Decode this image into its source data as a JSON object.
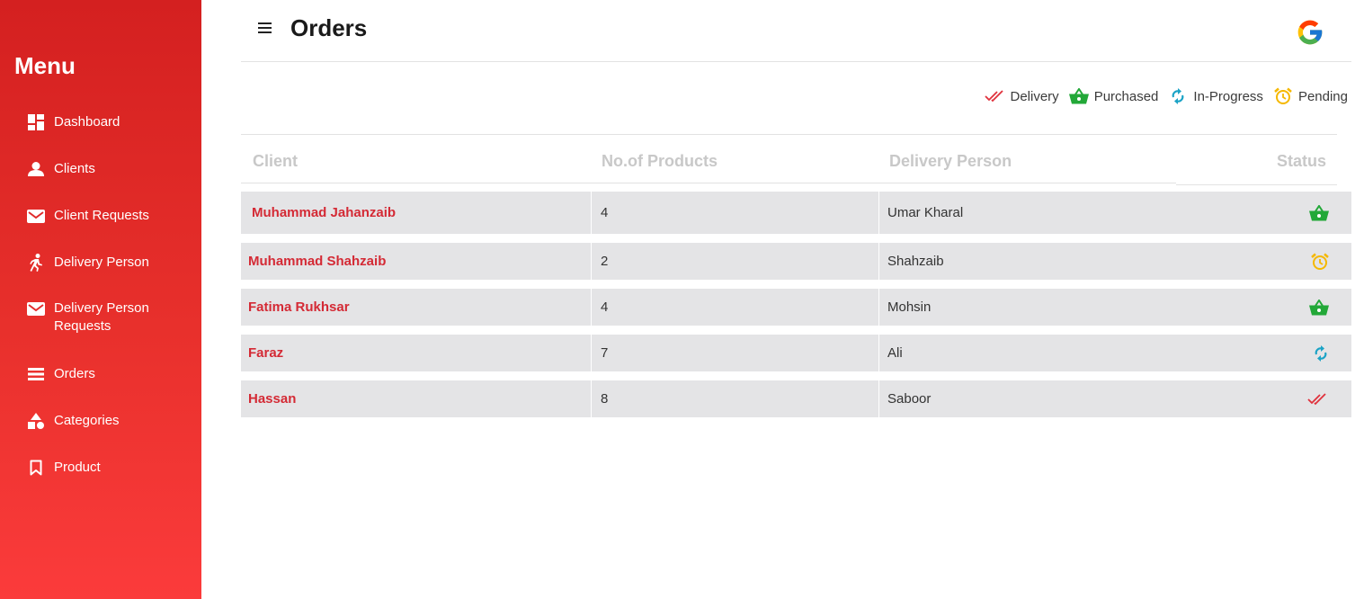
{
  "sidebar": {
    "title": "Menu",
    "items": [
      {
        "label": "Dashboard",
        "icon": "dashboard-icon"
      },
      {
        "label": "Clients",
        "icon": "user-icon"
      },
      {
        "label": "Client Requests",
        "icon": "envelope-icon"
      },
      {
        "label": "Delivery Person",
        "icon": "running-person-icon"
      },
      {
        "label": "Delivery Person Requests",
        "icon": "envelope-icon"
      },
      {
        "label": "Orders",
        "icon": "list-icon"
      },
      {
        "label": "Categories",
        "icon": "shapes-icon"
      },
      {
        "label": "Product",
        "icon": "bookmark-icon"
      }
    ]
  },
  "header": {
    "title": "Orders",
    "menu_icon": "hamburger-icon",
    "account_icon": "google-icon"
  },
  "legend": [
    {
      "label": "Delivery",
      "icon": "double-check-icon",
      "color": "#e0313c"
    },
    {
      "label": "Purchased",
      "icon": "basket-icon",
      "color": "#22a838"
    },
    {
      "label": "In-Progress",
      "icon": "sync-icon",
      "color": "#1ba3c6"
    },
    {
      "label": "Pending",
      "icon": "alarm-clock-icon",
      "color": "#f5b800"
    }
  ],
  "table": {
    "columns": [
      "Client",
      "No.of Products",
      "Delivery Person",
      "Status"
    ],
    "rows": [
      {
        "client": "Muhammad Jahanzaib",
        "products": "4",
        "delivery_person": "Umar Kharal",
        "status": "Purchased"
      },
      {
        "client": "Muhammad Shahzaib",
        "products": "2",
        "delivery_person": "Shahzaib",
        "status": "Pending"
      },
      {
        "client": "Fatima Rukhsar",
        "products": "4",
        "delivery_person": "Mohsin",
        "status": "Purchased"
      },
      {
        "client": "Faraz",
        "products": "7",
        "delivery_person": "Ali",
        "status": "In-Progress"
      },
      {
        "client": "Hassan",
        "products": "8",
        "delivery_person": "Saboor",
        "status": "Delivery"
      }
    ]
  },
  "colors": {
    "sidebar_top": "#d42020",
    "sidebar_bottom": "#fb3b3b",
    "client_name": "#d42a35",
    "row_bg": "#e4e4e6"
  }
}
